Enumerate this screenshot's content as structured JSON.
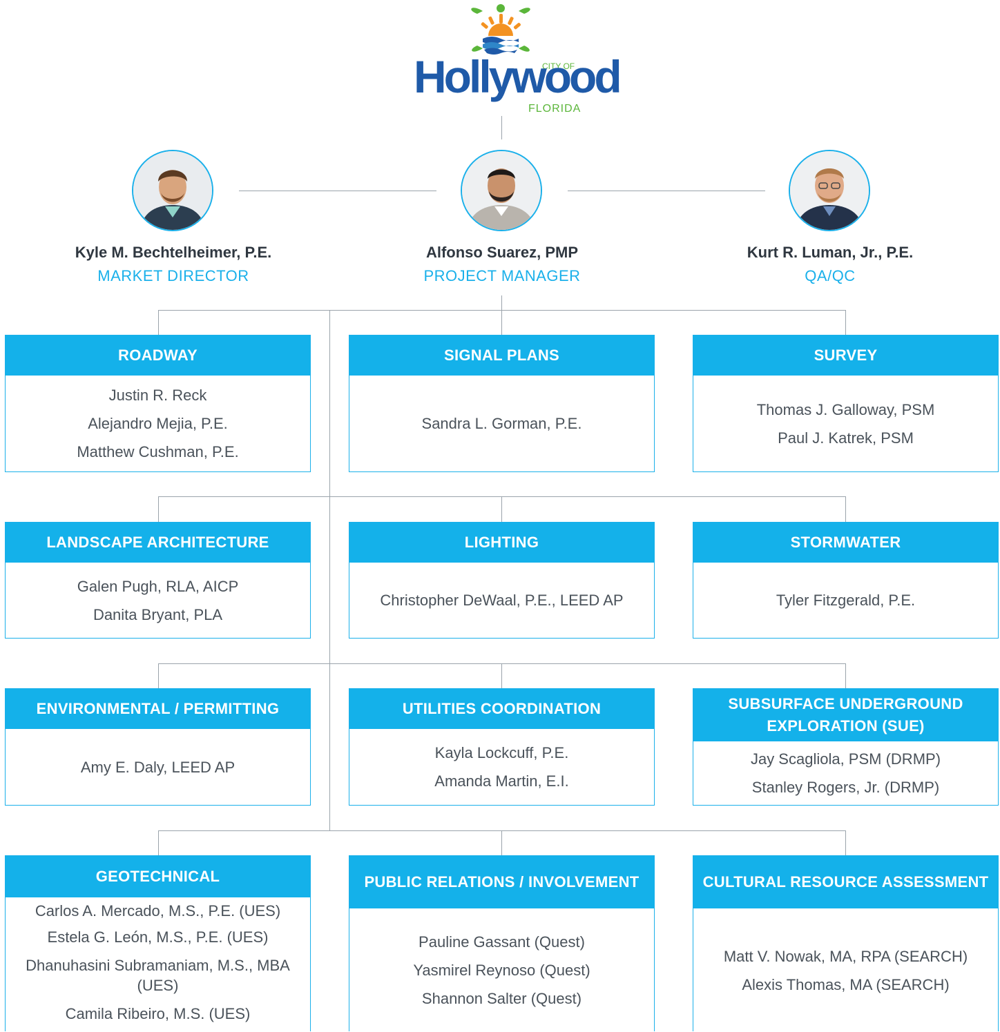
{
  "logo": {
    "city_of": "CITY OF",
    "name": "Hollywood",
    "state": "FLORIDA"
  },
  "colors": {
    "accent": "#14b1ea",
    "logo_blue": "#1f5aa8",
    "logo_green": "#5bb63a",
    "logo_orange": "#f39221",
    "connector": "#9aa3ab"
  },
  "leadership": [
    {
      "name": "Kyle M. Bechtelheimer, P.E.",
      "role": "MARKET DIRECTOR"
    },
    {
      "name": "Alfonso Suarez, PMP",
      "role": "PROJECT MANAGER"
    },
    {
      "name": "Kurt R. Luman, Jr., P.E.",
      "role": "QA/QC"
    }
  ],
  "disciplines": [
    {
      "title": "ROADWAY",
      "members": [
        "Justin R. Reck",
        "Alejandro Mejia, P.E.",
        "Matthew Cushman, P.E."
      ]
    },
    {
      "title": "SIGNAL PLANS",
      "members": [
        "Sandra L. Gorman, P.E."
      ]
    },
    {
      "title": "SURVEY",
      "members": [
        "Thomas J. Galloway, PSM",
        "Paul J. Katrek, PSM"
      ]
    },
    {
      "title": "LANDSCAPE ARCHITECTURE",
      "members": [
        "Galen Pugh, RLA, AICP",
        "Danita Bryant, PLA"
      ]
    },
    {
      "title": "LIGHTING",
      "members": [
        "Christopher DeWaal, P.E., LEED AP"
      ]
    },
    {
      "title": "STORMWATER",
      "members": [
        "Tyler Fitzgerald, P.E."
      ]
    },
    {
      "title": "ENVIRONMENTAL / PERMITTING",
      "members": [
        "Amy E. Daly, LEED AP"
      ]
    },
    {
      "title": "UTILITIES COORDINATION",
      "members": [
        "Kayla Lockcuff, P.E.",
        "Amanda Martin, E.I."
      ]
    },
    {
      "title": "SUBSURFACE UNDERGROUND EXPLORATION (SUE)",
      "members": [
        "Jay Scagliola, PSM (DRMP)",
        "Stanley Rogers, Jr. (DRMP)"
      ]
    },
    {
      "title": "GEOTECHNICAL",
      "members": [
        "Carlos A. Mercado, M.S., P.E. (UES)",
        "Estela G. León, M.S., P.E. (UES)",
        "Dhanuhasini Subramaniam, M.S., MBA (UES)",
        "Camila Ribeiro, M.S. (UES)"
      ]
    },
    {
      "title": "PUBLIC RELATIONS / INVOLVEMENT",
      "members": [
        "Pauline Gassant (Quest)",
        "Yasmirel Reynoso (Quest)",
        "Shannon Salter (Quest)"
      ]
    },
    {
      "title": "CULTURAL RESOURCE ASSESSMENT",
      "members": [
        "Matt V. Nowak, MA, RPA (SEARCH)",
        "Alexis Thomas, MA (SEARCH)"
      ]
    }
  ]
}
